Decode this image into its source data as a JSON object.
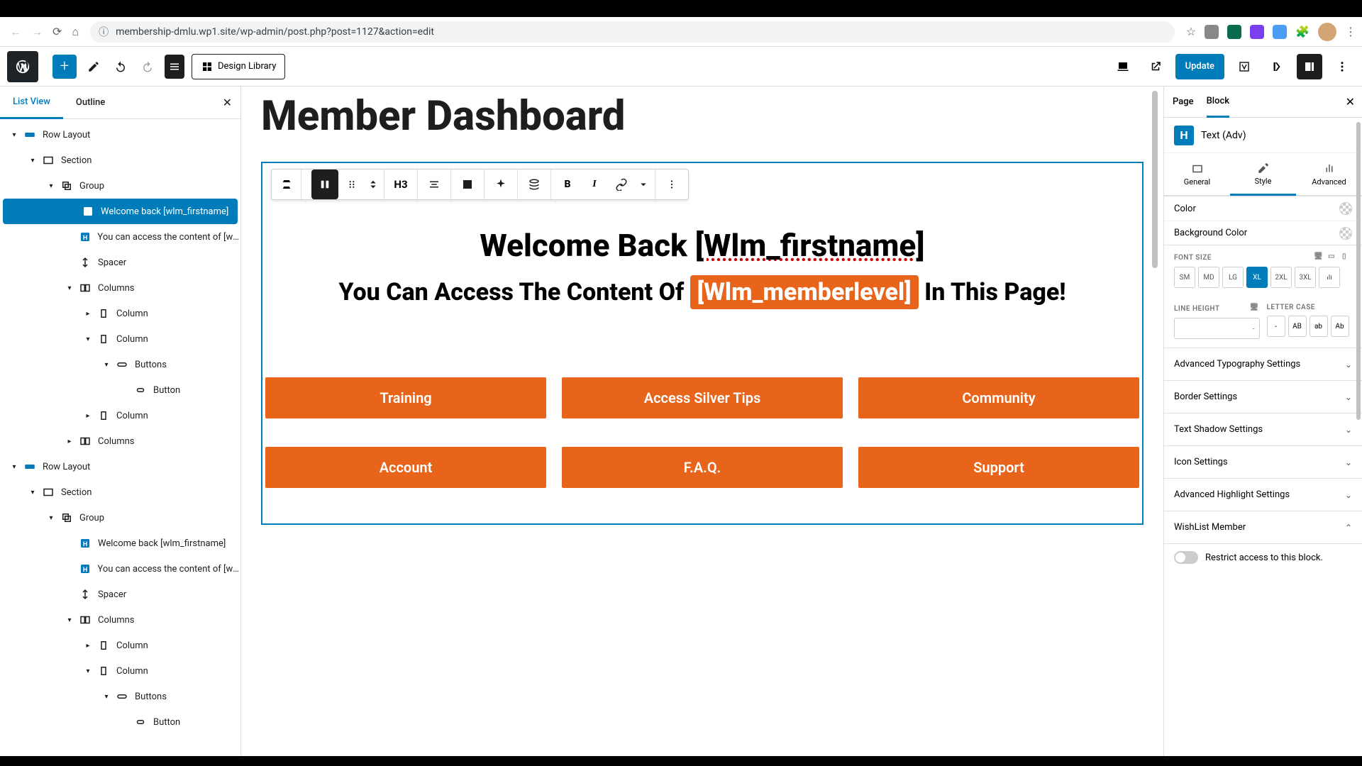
{
  "browser": {
    "url": "membership-dmlu.wp1.site/wp-admin/post.php?post=1127&action=edit"
  },
  "wpbar": {
    "design_library": "Design Library",
    "update": "Update"
  },
  "left_panel": {
    "tab_list": "List View",
    "tab_outline": "Outline"
  },
  "tree": [
    {
      "label": "Row Layout",
      "indent": 0,
      "caret": "▾",
      "icon": "row"
    },
    {
      "label": "Section",
      "indent": 1,
      "caret": "▾",
      "icon": "section"
    },
    {
      "label": "Group",
      "indent": 2,
      "caret": "▾",
      "icon": "group"
    },
    {
      "label": "Welcome back [wlm_firstname]",
      "indent": 3,
      "caret": "",
      "icon": "h",
      "selected": true
    },
    {
      "label": "You can access the content of [wl...",
      "indent": 3,
      "caret": "",
      "icon": "h"
    },
    {
      "label": "Spacer",
      "indent": 3,
      "caret": "",
      "icon": "spacer"
    },
    {
      "label": "Columns",
      "indent": 3,
      "caret": "▾",
      "icon": "columns"
    },
    {
      "label": "Column",
      "indent": 4,
      "caret": "▸",
      "icon": "column"
    },
    {
      "label": "Column",
      "indent": 4,
      "caret": "▾",
      "icon": "column"
    },
    {
      "label": "Buttons",
      "indent": 5,
      "caret": "▾",
      "icon": "buttons"
    },
    {
      "label": "Button",
      "indent": 6,
      "caret": "",
      "icon": "button"
    },
    {
      "label": "Column",
      "indent": 4,
      "caret": "▸",
      "icon": "column"
    },
    {
      "label": "Columns",
      "indent": 3,
      "caret": "▸",
      "icon": "columns"
    },
    {
      "label": "Row Layout",
      "indent": 0,
      "caret": "▾",
      "icon": "row"
    },
    {
      "label": "Section",
      "indent": 1,
      "caret": "▾",
      "icon": "section"
    },
    {
      "label": "Group",
      "indent": 2,
      "caret": "▾",
      "icon": "group"
    },
    {
      "label": "Welcome back [wlm_firstname]",
      "indent": 3,
      "caret": "",
      "icon": "h"
    },
    {
      "label": "You can access the content of [wl...",
      "indent": 3,
      "caret": "",
      "icon": "h"
    },
    {
      "label": "Spacer",
      "indent": 3,
      "caret": "",
      "icon": "spacer"
    },
    {
      "label": "Columns",
      "indent": 3,
      "caret": "▾",
      "icon": "columns"
    },
    {
      "label": "Column",
      "indent": 4,
      "caret": "▸",
      "icon": "column"
    },
    {
      "label": "Column",
      "indent": 4,
      "caret": "▾",
      "icon": "column"
    },
    {
      "label": "Buttons",
      "indent": 5,
      "caret": "▾",
      "icon": "buttons"
    },
    {
      "label": "Button",
      "indent": 6,
      "caret": "",
      "icon": "button"
    }
  ],
  "editor": {
    "page_title": "Member Dashboard",
    "heading_prefix": "Welcome Back ",
    "heading_shortcode": "[Wlm_firstname]",
    "sub_prefix": "You Can Access The Content Of ",
    "sub_highlight": "[Wlm_memberlevel]",
    "sub_suffix": " In This Page!",
    "buttons1": [
      "Training",
      "Access Silver Tips",
      "Community"
    ],
    "buttons2": [
      "Account",
      "F.A.Q.",
      "Support"
    ]
  },
  "toolbar": {
    "heading_level": "H3"
  },
  "right_panel": {
    "tab_page": "Page",
    "tab_block": "Block",
    "block_type": "Text (Adv)",
    "style_tabs": {
      "general": "General",
      "style": "Style",
      "advanced": "Advanced"
    },
    "color": "Color",
    "bg_color": "Background Color",
    "font_size_label": "FONT SIZE",
    "sizes": [
      "SM",
      "MD",
      "LG",
      "XL",
      "2XL",
      "3XL"
    ],
    "size_active": "XL",
    "line_height_label": "LINE HEIGHT",
    "line_height_unit": "-",
    "letter_case_label": "LETTER CASE",
    "cases": [
      "-",
      "AB",
      "ab",
      "Ab"
    ],
    "accordions": [
      "Advanced Typography Settings",
      "Border Settings",
      "Text Shadow Settings",
      "Icon Settings",
      "Advanced Highlight Settings"
    ],
    "wlm_label": "WishList Member",
    "restrict": "Restrict access to this block."
  }
}
